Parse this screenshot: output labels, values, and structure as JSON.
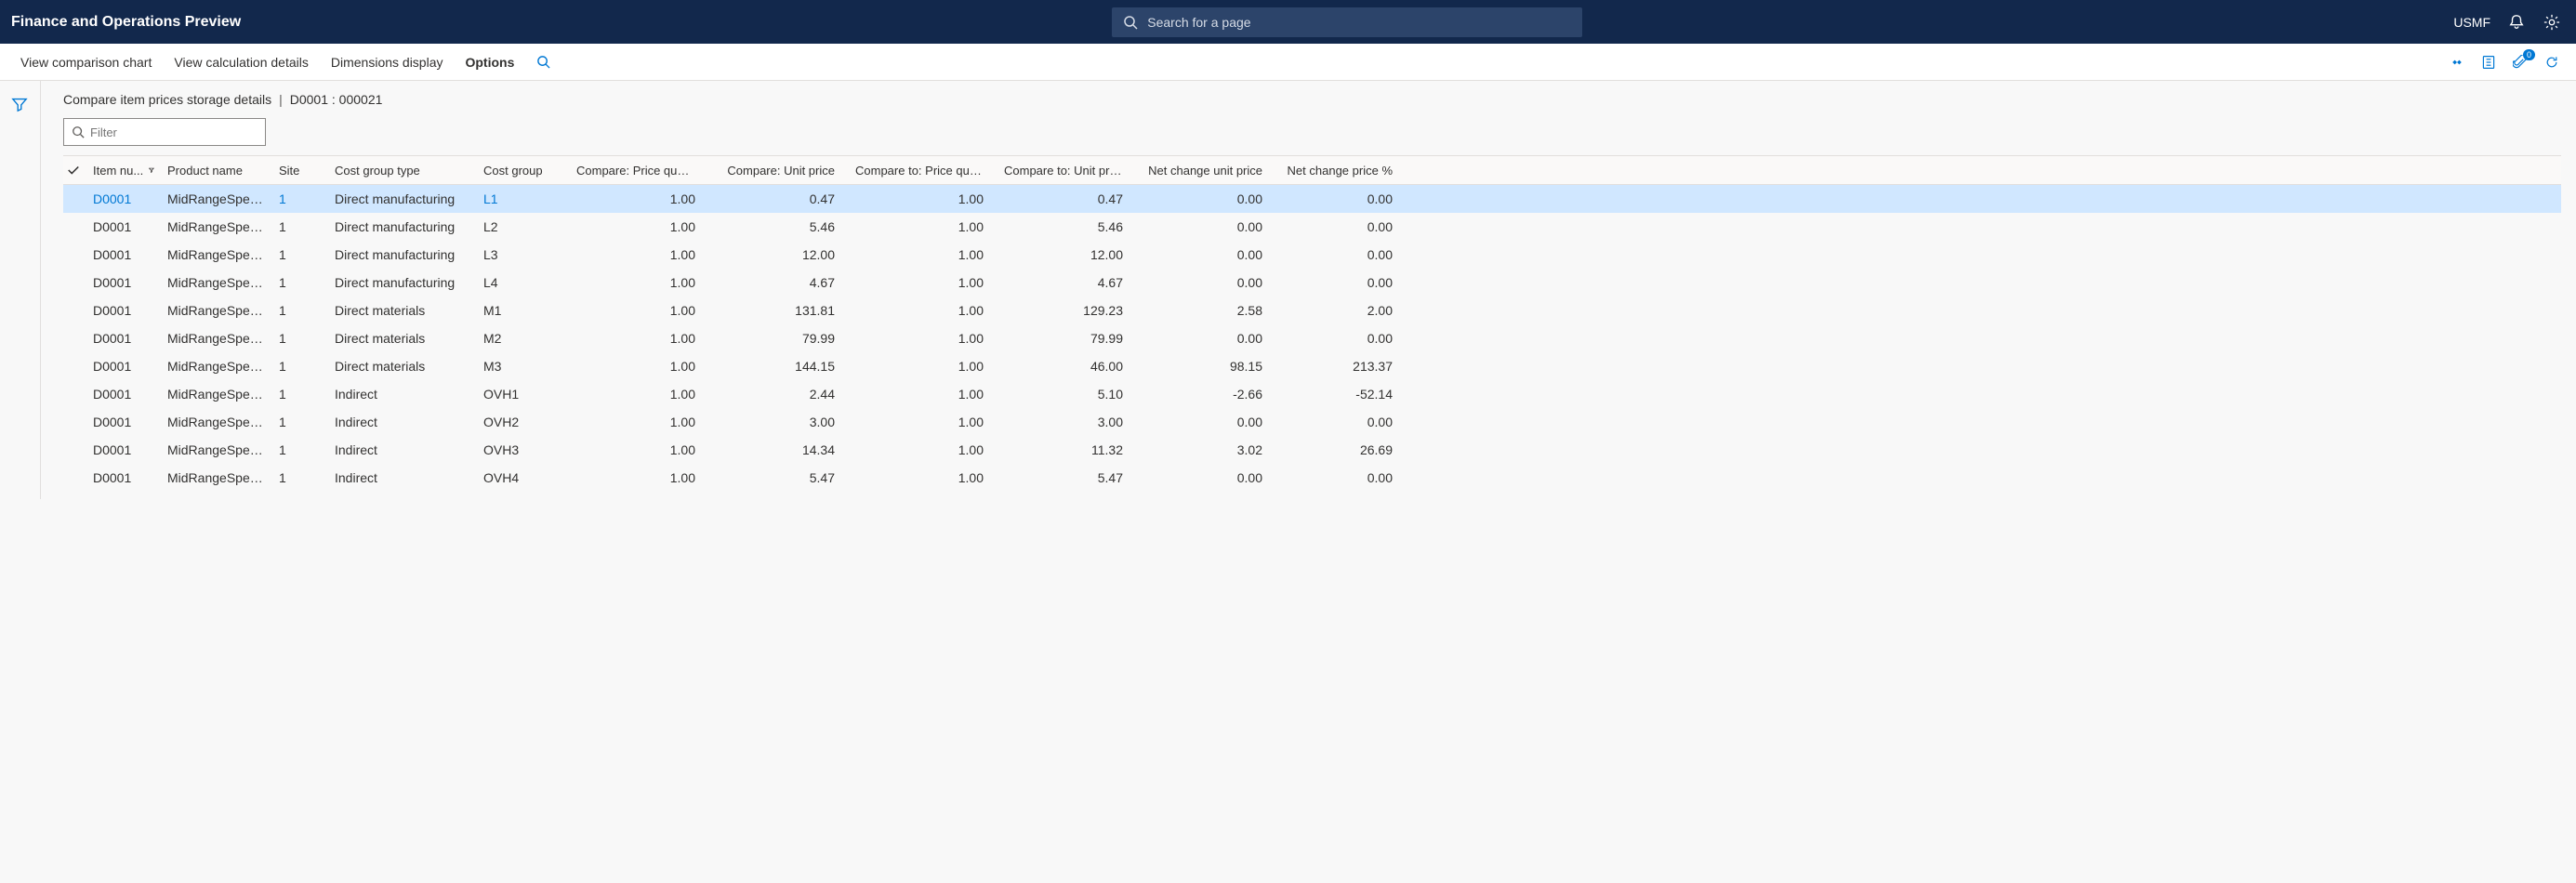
{
  "header": {
    "title": "Finance and Operations Preview",
    "search_placeholder": "Search for a page",
    "company": "USMF"
  },
  "actionbar": {
    "view_comparison_chart": "View comparison chart",
    "view_calculation_details": "View calculation details",
    "dimensions_display": "Dimensions display",
    "options": "Options",
    "attachment_count": "0"
  },
  "breadcrumb": {
    "title": "Compare item prices storage details",
    "detail": "D0001 : 000021"
  },
  "filter": {
    "placeholder": "Filter"
  },
  "columns": {
    "item": "Item nu...",
    "product": "Product name",
    "site": "Site",
    "cgt": "Cost group type",
    "cg": "Cost group",
    "cpq": "Compare: Price quantity",
    "cup": "Compare: Unit price",
    "ctpq": "Compare to: Price quantity",
    "ctup": "Compare to: Unit price",
    "ncup": "Net change unit price",
    "ncpp": "Net change price %"
  },
  "rows": [
    {
      "item": "D0001",
      "product": "MidRangeSpeak...",
      "site": "1",
      "cgt": "Direct manufacturing",
      "cg": "L1",
      "cpq": "1.00",
      "cup": "0.47",
      "ctpq": "1.00",
      "ctup": "0.47",
      "ncup": "0.00",
      "ncpp": "0.00",
      "selected": true
    },
    {
      "item": "D0001",
      "product": "MidRangeSpeak...",
      "site": "1",
      "cgt": "Direct manufacturing",
      "cg": "L2",
      "cpq": "1.00",
      "cup": "5.46",
      "ctpq": "1.00",
      "ctup": "5.46",
      "ncup": "0.00",
      "ncpp": "0.00"
    },
    {
      "item": "D0001",
      "product": "MidRangeSpeak...",
      "site": "1",
      "cgt": "Direct manufacturing",
      "cg": "L3",
      "cpq": "1.00",
      "cup": "12.00",
      "ctpq": "1.00",
      "ctup": "12.00",
      "ncup": "0.00",
      "ncpp": "0.00"
    },
    {
      "item": "D0001",
      "product": "MidRangeSpeak...",
      "site": "1",
      "cgt": "Direct manufacturing",
      "cg": "L4",
      "cpq": "1.00",
      "cup": "4.67",
      "ctpq": "1.00",
      "ctup": "4.67",
      "ncup": "0.00",
      "ncpp": "0.00"
    },
    {
      "item": "D0001",
      "product": "MidRangeSpeak...",
      "site": "1",
      "cgt": "Direct materials",
      "cg": "M1",
      "cpq": "1.00",
      "cup": "131.81",
      "ctpq": "1.00",
      "ctup": "129.23",
      "ncup": "2.58",
      "ncpp": "2.00"
    },
    {
      "item": "D0001",
      "product": "MidRangeSpeak...",
      "site": "1",
      "cgt": "Direct materials",
      "cg": "M2",
      "cpq": "1.00",
      "cup": "79.99",
      "ctpq": "1.00",
      "ctup": "79.99",
      "ncup": "0.00",
      "ncpp": "0.00"
    },
    {
      "item": "D0001",
      "product": "MidRangeSpeak...",
      "site": "1",
      "cgt": "Direct materials",
      "cg": "M3",
      "cpq": "1.00",
      "cup": "144.15",
      "ctpq": "1.00",
      "ctup": "46.00",
      "ncup": "98.15",
      "ncpp": "213.37"
    },
    {
      "item": "D0001",
      "product": "MidRangeSpeak...",
      "site": "1",
      "cgt": "Indirect",
      "cg": "OVH1",
      "cpq": "1.00",
      "cup": "2.44",
      "ctpq": "1.00",
      "ctup": "5.10",
      "ncup": "-2.66",
      "ncpp": "-52.14"
    },
    {
      "item": "D0001",
      "product": "MidRangeSpeak...",
      "site": "1",
      "cgt": "Indirect",
      "cg": "OVH2",
      "cpq": "1.00",
      "cup": "3.00",
      "ctpq": "1.00",
      "ctup": "3.00",
      "ncup": "0.00",
      "ncpp": "0.00"
    },
    {
      "item": "D0001",
      "product": "MidRangeSpeak...",
      "site": "1",
      "cgt": "Indirect",
      "cg": "OVH3",
      "cpq": "1.00",
      "cup": "14.34",
      "ctpq": "1.00",
      "ctup": "11.32",
      "ncup": "3.02",
      "ncpp": "26.69"
    },
    {
      "item": "D0001",
      "product": "MidRangeSpeak...",
      "site": "1",
      "cgt": "Indirect",
      "cg": "OVH4",
      "cpq": "1.00",
      "cup": "5.47",
      "ctpq": "1.00",
      "ctup": "5.47",
      "ncup": "0.00",
      "ncpp": "0.00"
    }
  ]
}
